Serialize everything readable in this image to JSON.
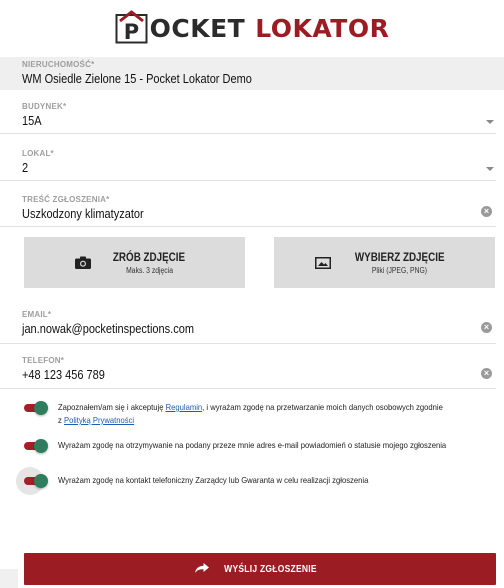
{
  "brand": {
    "logo_letter": "P",
    "word_dark": "OCKET",
    "word_red": "LOKATOR",
    "accent": "#9b1c22",
    "toggle_thumb": "#2e7d5c"
  },
  "form": {
    "property": {
      "label": "NIERUCHOMOŚĆ*",
      "value": "WM Osiedle Zielone 15 - Pocket Lokator Demo"
    },
    "building": {
      "label": "BUDYNEK*",
      "value": "15A"
    },
    "unit": {
      "label": "LOKAL*",
      "value": "2"
    },
    "report": {
      "label": "TREŚĆ ZGŁOSZENIA*",
      "value": "Uszkodzony klimatyzator"
    },
    "email": {
      "label": "EMAIL*",
      "value": "jan.nowak@pocketinspections.com"
    },
    "phone": {
      "label": "TELEFON*",
      "value": "+48 123 456 789"
    }
  },
  "photos": {
    "take": {
      "title": "ZRÓB ZDJĘCIE",
      "subtitle": "Maks. 3 zdjęcia",
      "icon": "camera-icon"
    },
    "choose": {
      "title": "WYBIERZ ZDJĘCIE",
      "subtitle": "Pliki (JPEG, PNG)",
      "icon": "image-icon"
    }
  },
  "consents": {
    "c1": {
      "pre": "Zapoznałem/am się i akceptuję ",
      "link1": "Regulamin",
      "mid": ", i wyrażam zgodę na przetwarzanie moich danych osobowych zgodnie z ",
      "link2": "Polityką Prywatności",
      "checked": true
    },
    "c2": {
      "text": "Wyrażam zgodę na otrzymywanie na podany przeze mnie adres e-mail powiadomień o statusie mojego zgłoszenia",
      "checked": true
    },
    "c3": {
      "text": "Wyrażam zgodę na kontakt telefoniczny Zarządcy lub Gwaranta w celu realizacji zgłoszenia",
      "checked": true
    }
  },
  "submit": {
    "label": "WYŚLIJ ZGŁOSZENIE",
    "icon": "share-arrow-icon"
  }
}
